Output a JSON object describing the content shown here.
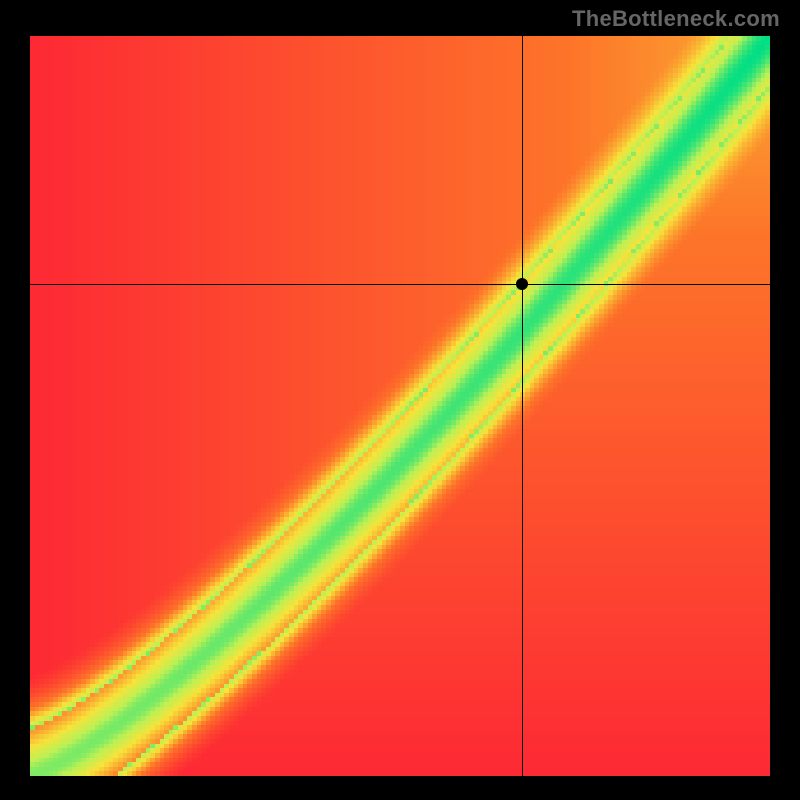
{
  "watermark": "TheBottleneck.com",
  "chart_data": {
    "type": "heatmap",
    "title": "",
    "xlabel": "",
    "ylabel": "",
    "xlim": [
      0,
      1
    ],
    "ylim": [
      0,
      1
    ],
    "resolution": 160,
    "marker": {
      "x": 0.665,
      "y": 0.665
    },
    "crosshair": {
      "x": 0.665,
      "y": 0.665
    },
    "ideal_curve_power": 1.25,
    "band_half_width": 0.055,
    "curve_weight": 0.7,
    "gradient": [
      {
        "t": 0.0,
        "r": 253,
        "g": 41,
        "b": 52
      },
      {
        "t": 0.4,
        "r": 253,
        "g": 116,
        "b": 41
      },
      {
        "t": 0.7,
        "r": 247,
        "g": 227,
        "b": 58
      },
      {
        "t": 0.85,
        "r": 189,
        "g": 240,
        "b": 84
      },
      {
        "t": 1.0,
        "r": 0,
        "g": 222,
        "b": 133
      }
    ]
  }
}
